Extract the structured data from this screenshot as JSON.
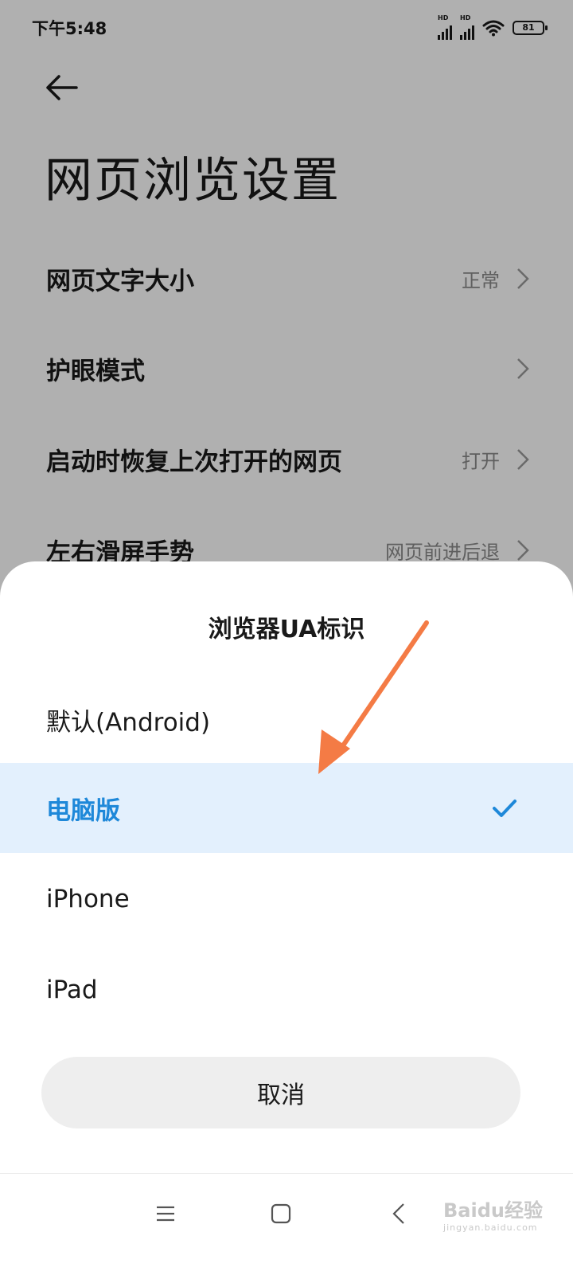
{
  "status_bar": {
    "time": "下午5:48",
    "signal_label": "HD",
    "battery": "81"
  },
  "page": {
    "title": "网页浏览设置",
    "rows": [
      {
        "label": "网页文字大小",
        "value": "正常"
      },
      {
        "label": "护眼模式",
        "value": ""
      },
      {
        "label": "启动时恢复上次打开的网页",
        "value": "打开"
      },
      {
        "label": "左右滑屏手势",
        "value": "网页前进后退"
      }
    ]
  },
  "sheet": {
    "title": "浏览器UA标识",
    "options": [
      {
        "label": "默认(Android)",
        "selected": false
      },
      {
        "label": "电脑版",
        "selected": true
      },
      {
        "label": "iPhone",
        "selected": false
      },
      {
        "label": "iPad",
        "selected": false
      }
    ],
    "cancel_label": "取消"
  },
  "watermark": {
    "main": "Baidu经验",
    "sub": "jingyan.baidu.com"
  },
  "colors": {
    "accent": "#1e88d9",
    "selected_bg": "#e3f0fd",
    "annotation_arrow": "#f47b45"
  }
}
